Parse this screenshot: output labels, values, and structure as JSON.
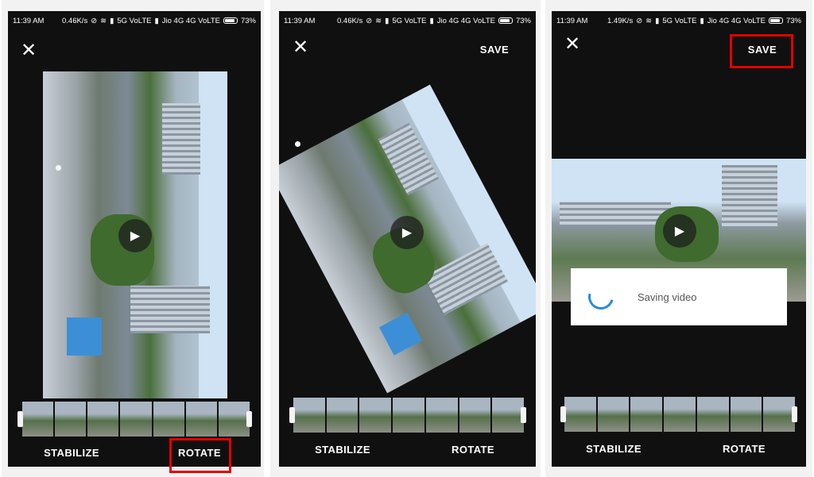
{
  "status_bar": {
    "time": "11:39 AM",
    "speed_1": "0.46K/s",
    "speed_2": "0.46K/s",
    "speed_3": "1.49K/s",
    "network_1": "5G VoLTE",
    "network_2": "Jio 4G 4G VoLTE",
    "battery": "73%"
  },
  "screens": [
    {
      "close_label": "✕",
      "stabilize_label": "STABILIZE",
      "rotate_label": "ROTATE",
      "save_label": ""
    },
    {
      "close_label": "✕",
      "stabilize_label": "STABILIZE",
      "rotate_label": "ROTATE",
      "save_label": "SAVE"
    },
    {
      "close_label": "✕",
      "stabilize_label": "STABILIZE",
      "rotate_label": "ROTATE",
      "save_label": "SAVE"
    }
  ],
  "dialog": {
    "text": "Saving video"
  },
  "icons": {
    "play": "▶",
    "close": "close-icon",
    "wifi": "wifi-icon",
    "signal": "signal-icon",
    "mute": "bell-off-icon",
    "battery": "battery-icon"
  },
  "colors": {
    "highlight": "#e30000",
    "spinner": "#2a8bd8",
    "screen_bg": "#101010"
  }
}
